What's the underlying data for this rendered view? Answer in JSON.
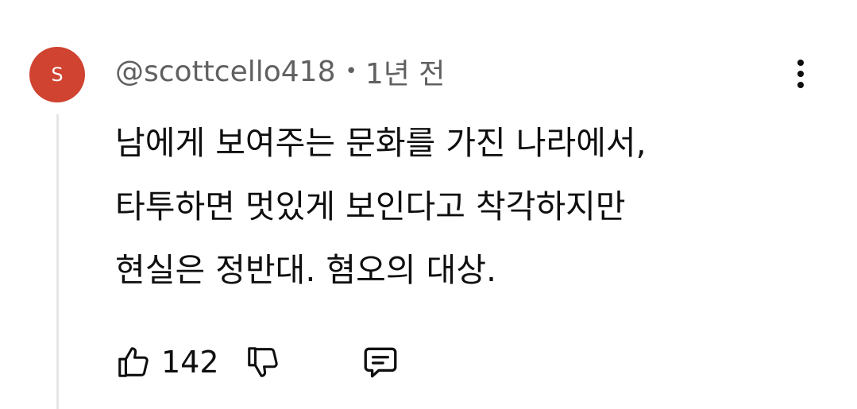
{
  "comment": {
    "avatar_letter": "S",
    "avatar_color": "#cf4330",
    "author": "@scottcello418",
    "separator": "•",
    "time_ago": "1년 전",
    "text_lines": [
      "남에게 보여주는 문화를 가진 나라에서,",
      "타투하면 멋있게 보인다고 착각하지만",
      "현실은 정반대. 혐오의 대상."
    ],
    "like_count": "142",
    "icons": {
      "like": "thumbs-up-icon",
      "dislike": "thumbs-down-icon",
      "reply": "reply-comment-icon",
      "menu": "more-vertical-icon"
    }
  }
}
